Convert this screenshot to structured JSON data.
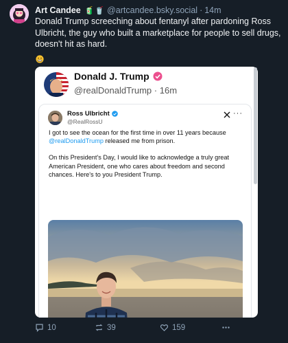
{
  "post": {
    "author_name": "Art Candee",
    "author_emojis": "🧃🥤",
    "author_handle": "@artcandee.bsky.social",
    "separator": "·",
    "time": "14m",
    "text": "Donald Trump screeching about fentanyl after pardoning Ross Ulbricht, the guy who built a marketplace for people to sell drugs, doesn't hit as hard.",
    "reaction_emoji": "grimace-emoji"
  },
  "embed": {
    "author_name": "Donald J. Trump",
    "author_handle": "@realDonaldTrump",
    "separator": "·",
    "time": "16m",
    "verified_color": "#ec4f8e",
    "quoted": {
      "author_name": "Ross Ulbricht",
      "author_handle": "@RealRossU",
      "more": "···",
      "text_1a": "I got to see the ocean for the first time in over 11 years because ",
      "text_1_mention": "@realDonaldTrump",
      "text_1b": " released me from prison.",
      "text_2": "On this President's Day, I would like to acknowledge a truly great American President, one who cares about freedom and second chances. Here's to you President Trump.",
      "photo": "man-on-beach-photo"
    }
  },
  "actions": {
    "replies": "10",
    "reposts": "39",
    "likes": "159"
  },
  "colors": {
    "background": "#161e27",
    "text": "#f1f3f5",
    "muted": "#8fa3b8",
    "link": "#1d9bf0"
  }
}
